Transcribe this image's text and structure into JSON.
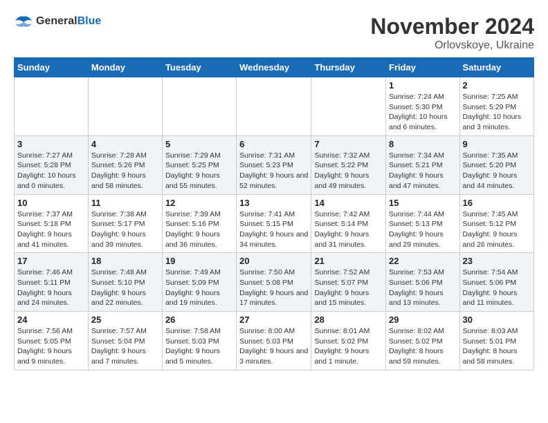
{
  "logo": {
    "general": "General",
    "blue": "Blue"
  },
  "title": {
    "month_year": "November 2024",
    "location": "Orlovskoye, Ukraine"
  },
  "weekdays": [
    "Sunday",
    "Monday",
    "Tuesday",
    "Wednesday",
    "Thursday",
    "Friday",
    "Saturday"
  ],
  "weeks": [
    [
      {
        "day": "",
        "info": ""
      },
      {
        "day": "",
        "info": ""
      },
      {
        "day": "",
        "info": ""
      },
      {
        "day": "",
        "info": ""
      },
      {
        "day": "",
        "info": ""
      },
      {
        "day": "1",
        "info": "Sunrise: 7:24 AM\nSunset: 5:30 PM\nDaylight: 10 hours and 6 minutes."
      },
      {
        "day": "2",
        "info": "Sunrise: 7:25 AM\nSunset: 5:29 PM\nDaylight: 10 hours and 3 minutes."
      }
    ],
    [
      {
        "day": "3",
        "info": "Sunrise: 7:27 AM\nSunset: 5:28 PM\nDaylight: 10 hours and 0 minutes."
      },
      {
        "day": "4",
        "info": "Sunrise: 7:28 AM\nSunset: 5:26 PM\nDaylight: 9 hours and 58 minutes."
      },
      {
        "day": "5",
        "info": "Sunrise: 7:29 AM\nSunset: 5:25 PM\nDaylight: 9 hours and 55 minutes."
      },
      {
        "day": "6",
        "info": "Sunrise: 7:31 AM\nSunset: 5:23 PM\nDaylight: 9 hours and 52 minutes."
      },
      {
        "day": "7",
        "info": "Sunrise: 7:32 AM\nSunset: 5:22 PM\nDaylight: 9 hours and 49 minutes."
      },
      {
        "day": "8",
        "info": "Sunrise: 7:34 AM\nSunset: 5:21 PM\nDaylight: 9 hours and 47 minutes."
      },
      {
        "day": "9",
        "info": "Sunrise: 7:35 AM\nSunset: 5:20 PM\nDaylight: 9 hours and 44 minutes."
      }
    ],
    [
      {
        "day": "10",
        "info": "Sunrise: 7:37 AM\nSunset: 5:18 PM\nDaylight: 9 hours and 41 minutes."
      },
      {
        "day": "11",
        "info": "Sunrise: 7:38 AM\nSunset: 5:17 PM\nDaylight: 9 hours and 39 minutes."
      },
      {
        "day": "12",
        "info": "Sunrise: 7:39 AM\nSunset: 5:16 PM\nDaylight: 9 hours and 36 minutes."
      },
      {
        "day": "13",
        "info": "Sunrise: 7:41 AM\nSunset: 5:15 PM\nDaylight: 9 hours and 34 minutes."
      },
      {
        "day": "14",
        "info": "Sunrise: 7:42 AM\nSunset: 5:14 PM\nDaylight: 9 hours and 31 minutes."
      },
      {
        "day": "15",
        "info": "Sunrise: 7:44 AM\nSunset: 5:13 PM\nDaylight: 9 hours and 29 minutes."
      },
      {
        "day": "16",
        "info": "Sunrise: 7:45 AM\nSunset: 5:12 PM\nDaylight: 9 hours and 26 minutes."
      }
    ],
    [
      {
        "day": "17",
        "info": "Sunrise: 7:46 AM\nSunset: 5:11 PM\nDaylight: 9 hours and 24 minutes."
      },
      {
        "day": "18",
        "info": "Sunrise: 7:48 AM\nSunset: 5:10 PM\nDaylight: 9 hours and 22 minutes."
      },
      {
        "day": "19",
        "info": "Sunrise: 7:49 AM\nSunset: 5:09 PM\nDaylight: 9 hours and 19 minutes."
      },
      {
        "day": "20",
        "info": "Sunrise: 7:50 AM\nSunset: 5:08 PM\nDaylight: 9 hours and 17 minutes."
      },
      {
        "day": "21",
        "info": "Sunrise: 7:52 AM\nSunset: 5:07 PM\nDaylight: 9 hours and 15 minutes."
      },
      {
        "day": "22",
        "info": "Sunrise: 7:53 AM\nSunset: 5:06 PM\nDaylight: 9 hours and 13 minutes."
      },
      {
        "day": "23",
        "info": "Sunrise: 7:54 AM\nSunset: 5:06 PM\nDaylight: 9 hours and 11 minutes."
      }
    ],
    [
      {
        "day": "24",
        "info": "Sunrise: 7:56 AM\nSunset: 5:05 PM\nDaylight: 9 hours and 9 minutes."
      },
      {
        "day": "25",
        "info": "Sunrise: 7:57 AM\nSunset: 5:04 PM\nDaylight: 9 hours and 7 minutes."
      },
      {
        "day": "26",
        "info": "Sunrise: 7:58 AM\nSunset: 5:03 PM\nDaylight: 9 hours and 5 minutes."
      },
      {
        "day": "27",
        "info": "Sunrise: 8:00 AM\nSunset: 5:03 PM\nDaylight: 9 hours and 3 minutes."
      },
      {
        "day": "28",
        "info": "Sunrise: 8:01 AM\nSunset: 5:02 PM\nDaylight: 9 hours and 1 minute."
      },
      {
        "day": "29",
        "info": "Sunrise: 8:02 AM\nSunset: 5:02 PM\nDaylight: 8 hours and 59 minutes."
      },
      {
        "day": "30",
        "info": "Sunrise: 8:03 AM\nSunset: 5:01 PM\nDaylight: 8 hours and 58 minutes."
      }
    ]
  ]
}
